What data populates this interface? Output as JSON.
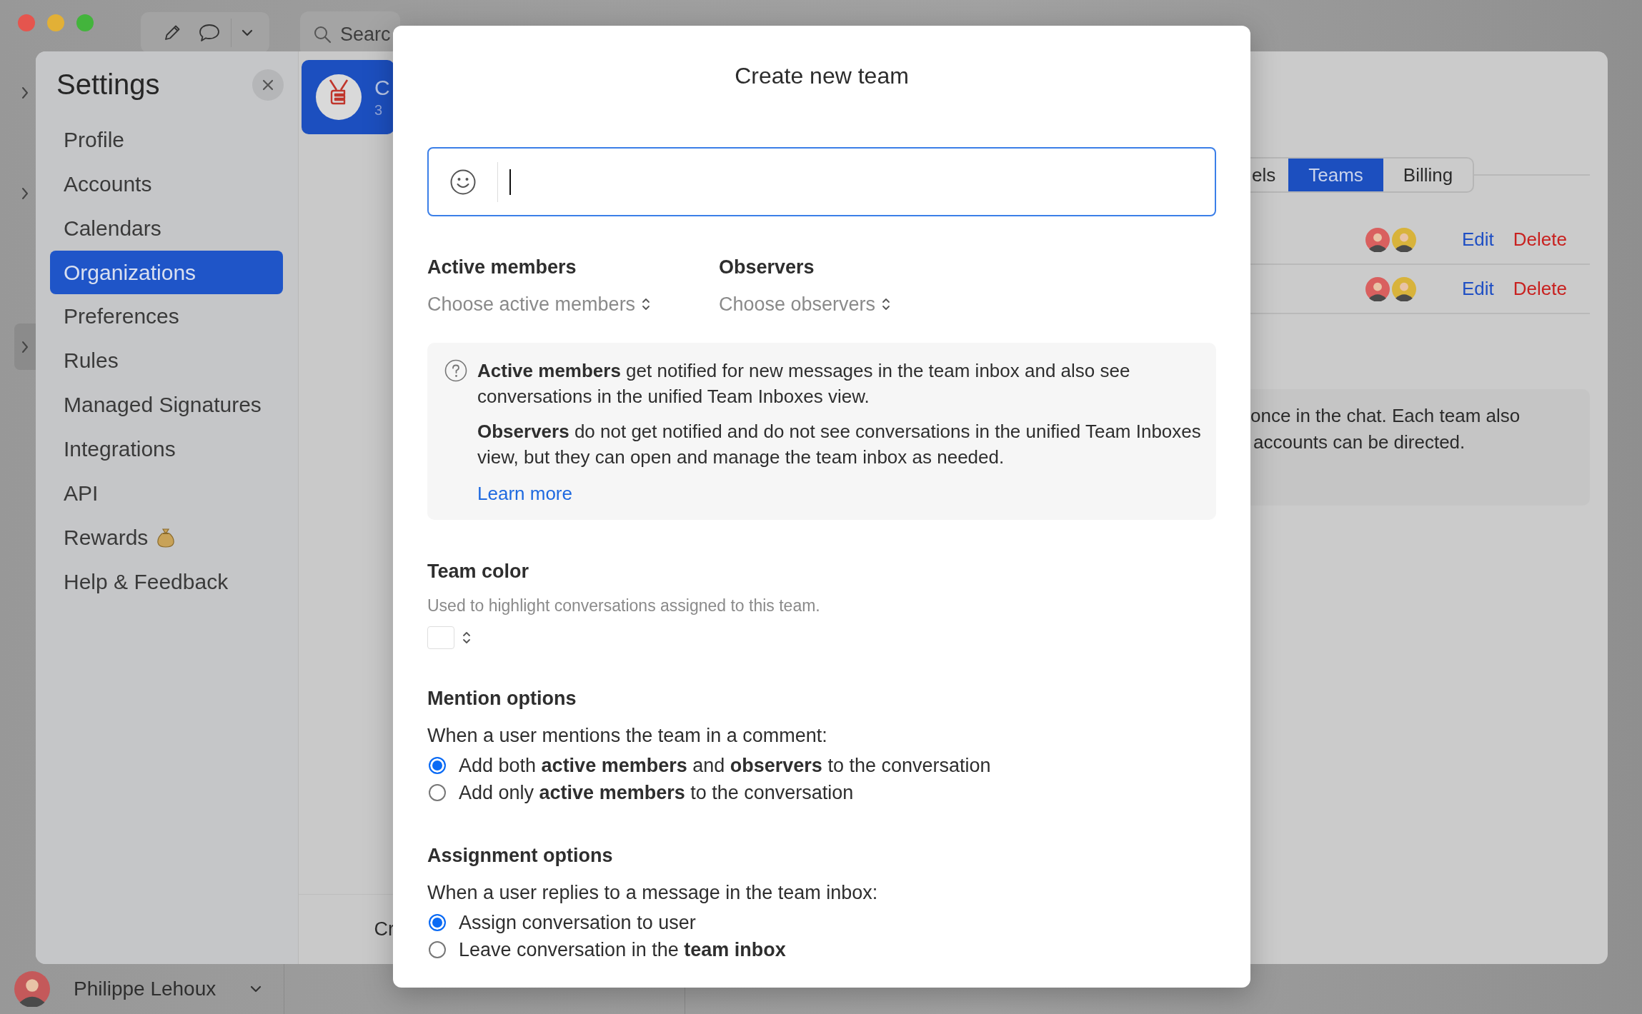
{
  "window": {
    "search": {
      "hint": "Searc"
    },
    "list_card": {
      "title": "C",
      "subtitle": "3",
      "selected": true
    },
    "list_footer": "Cr",
    "user": {
      "name": "Philippe Lehoux"
    }
  },
  "settings": {
    "title": "Settings",
    "items": [
      {
        "label": "Profile",
        "selected": false,
        "kind": "plain"
      },
      {
        "label": "Accounts",
        "selected": false,
        "kind": "plain"
      },
      {
        "label": "Calendars",
        "selected": false,
        "kind": "plain"
      },
      {
        "label": "Organizations",
        "selected": true,
        "kind": "plain"
      },
      {
        "label": "Preferences",
        "selected": false,
        "kind": "plain"
      },
      {
        "label": "Rules",
        "selected": false,
        "kind": "plain"
      },
      {
        "label": "Managed Signatures",
        "selected": false,
        "kind": "plain"
      },
      {
        "label": "Integrations",
        "selected": false,
        "kind": "plain"
      },
      {
        "label": "API",
        "selected": false,
        "kind": "plain"
      },
      {
        "label": "Rewards",
        "selected": false,
        "kind": "reward"
      },
      {
        "label": "Help & Feedback",
        "selected": false,
        "kind": "plain"
      }
    ]
  },
  "background_pane": {
    "tabs": [
      {
        "label": "els",
        "selected": false
      },
      {
        "label": "Teams",
        "selected": true
      },
      {
        "label": "Billing",
        "selected": false
      }
    ],
    "team_rows": [
      {
        "edit": "Edit",
        "delete": "Delete"
      },
      {
        "edit": "Edit",
        "delete": "Delete"
      }
    ],
    "note": [
      "once in the chat. Each team also",
      "accounts can be directed."
    ]
  },
  "dialog": {
    "title": "Create new team",
    "member_pickers": [
      {
        "label": "Active members",
        "hint": "Choose active members"
      },
      {
        "label": "Observers",
        "hint": "Choose observers"
      }
    ],
    "info": {
      "paragraphs": [
        "**Active members** get notified for new messages in the team inbox and also see conversations in the unified Team Inboxes view.",
        "**Observers** do not get notified and do not see conversations in the unified Team Inboxes view, but they can open and manage the team inbox as needed."
      ],
      "link": "Learn more"
    },
    "team_color": {
      "title": "Team color",
      "description": "Used to highlight conversations assigned to this team."
    },
    "option_groups": [
      {
        "title": "Mention options",
        "prompt": "When a user mentions the team in a comment:",
        "options": [
          {
            "label": "Add both **active members** and **observers** to the conversation",
            "selected": true
          },
          {
            "label": "Add only **active members** to the conversation",
            "selected": false
          }
        ]
      },
      {
        "title": "Assignment options",
        "prompt": "When a user replies to a message in the team inbox:",
        "options": [
          {
            "label": "Assign conversation to user",
            "selected": true
          },
          {
            "label": "Leave conversation in the **team inbox**",
            "selected": false
          }
        ]
      }
    ]
  }
}
